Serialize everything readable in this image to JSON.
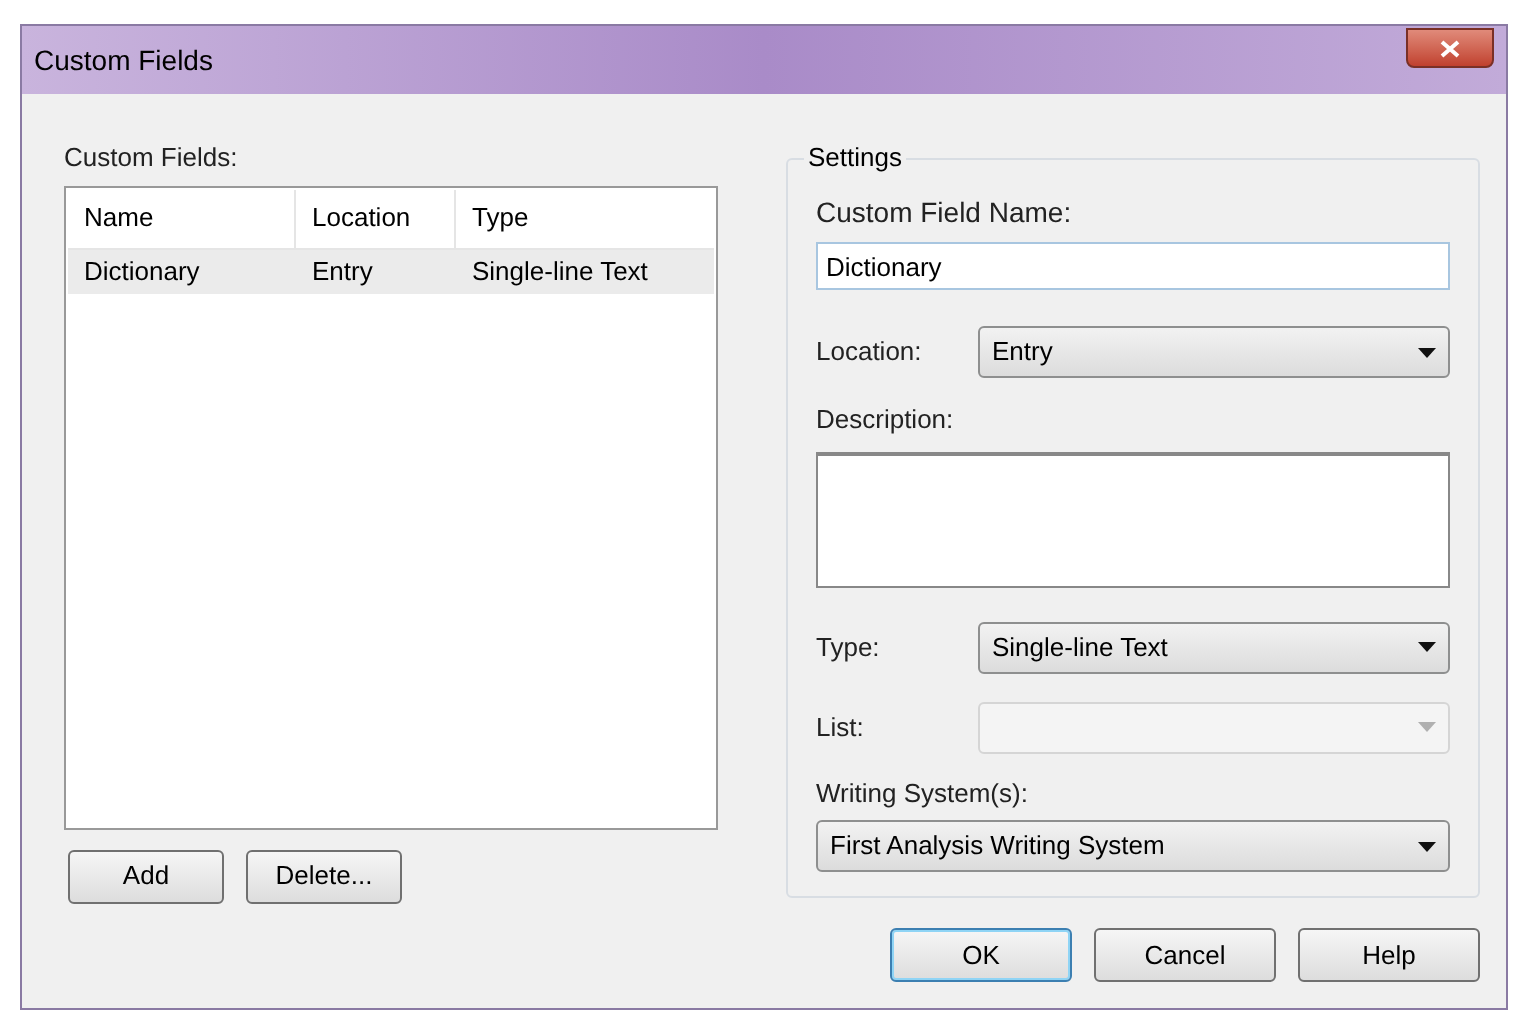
{
  "window": {
    "title": "Custom Fields"
  },
  "fields_list": {
    "label": "Custom Fields:",
    "columns": [
      "Name",
      "Location",
      "Type"
    ],
    "rows": [
      {
        "cells": [
          "Dictionary",
          "Entry",
          "Single-line Text"
        ],
        "selected": true
      }
    ],
    "buttons": [
      "Add",
      "Delete..."
    ]
  },
  "settings": {
    "title": "Settings",
    "name_label": "Custom Field Name:",
    "name_value": "Dictionary",
    "location": {
      "label": "Location:",
      "value": "Entry",
      "disabled": false
    },
    "description_label": "Description:",
    "type": {
      "label": "Type:",
      "value": "Single-line Text",
      "disabled": false
    },
    "list": {
      "label": "List:",
      "disabled": true
    },
    "writing_system": {
      "label": "Writing System(s):",
      "value": "First Analysis Writing System",
      "disabled": false
    }
  },
  "buttons": [
    {
      "label": "OK",
      "default": true
    },
    {
      "label": "Cancel",
      "default": false
    },
    {
      "label": "Help",
      "default": false
    }
  ]
}
